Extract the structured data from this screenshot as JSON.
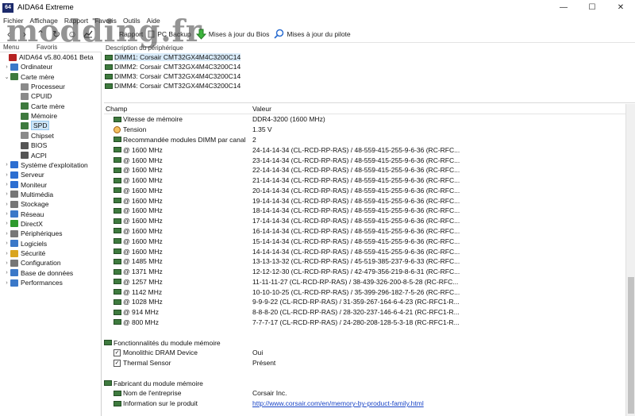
{
  "window": {
    "title": "AIDA64 Extreme",
    "app_icon": "64",
    "controls": [
      "—",
      "☐",
      "✕"
    ]
  },
  "watermark": "modding.fr",
  "menu": [
    "Fichier",
    "Affichage",
    "Rapport",
    "Favoris",
    "Outils",
    "Aide"
  ],
  "toolbar": {
    "items": [
      {
        "label": "Rapport"
      },
      {
        "label": "PC Backup"
      },
      {
        "label": "Mises à jour du Bios"
      },
      {
        "label": "Mises à jour du pilote"
      }
    ]
  },
  "left_tabs": [
    "Menu",
    "Favoris"
  ],
  "tree": [
    {
      "label": "AIDA64 v5.80.4061 Beta",
      "level": 0,
      "exp": "",
      "color": "#b52222"
    },
    {
      "label": "Ordinateur",
      "level": 1,
      "exp": "›",
      "color": "#3a78c8"
    },
    {
      "label": "Carte mère",
      "level": 1,
      "exp": "⌄",
      "color": "#3e7a3e"
    },
    {
      "label": "Processeur",
      "level": 2,
      "exp": "",
      "color": "#8a8a8a"
    },
    {
      "label": "CPUID",
      "level": 2,
      "exp": "",
      "color": "#8a8a8a"
    },
    {
      "label": "Carte mère",
      "level": 2,
      "exp": "",
      "color": "#3e7a3e"
    },
    {
      "label": "Mémoire",
      "level": 2,
      "exp": "",
      "color": "#3e7a3e"
    },
    {
      "label": "SPD",
      "level": 2,
      "exp": "",
      "color": "#3e7a3e",
      "selected": true
    },
    {
      "label": "Chipset",
      "level": 2,
      "exp": "",
      "color": "#8a8a8a"
    },
    {
      "label": "BIOS",
      "level": 2,
      "exp": "",
      "color": "#555555"
    },
    {
      "label": "ACPI",
      "level": 2,
      "exp": "",
      "color": "#555555"
    },
    {
      "label": "Système d'exploitation",
      "level": 1,
      "exp": "›",
      "color": "#2c6ed1"
    },
    {
      "label": "Serveur",
      "level": 1,
      "exp": "›",
      "color": "#2c6ed1"
    },
    {
      "label": "Moniteur",
      "level": 1,
      "exp": "›",
      "color": "#2c6ed1"
    },
    {
      "label": "Multimédia",
      "level": 1,
      "exp": "›",
      "color": "#777777"
    },
    {
      "label": "Stockage",
      "level": 1,
      "exp": "›",
      "color": "#777777"
    },
    {
      "label": "Réseau",
      "level": 1,
      "exp": "›",
      "color": "#3a78c8"
    },
    {
      "label": "DirectX",
      "level": 1,
      "exp": "›",
      "color": "#2e9a2e"
    },
    {
      "label": "Périphériques",
      "level": 1,
      "exp": "›",
      "color": "#777777"
    },
    {
      "label": "Logiciels",
      "level": 1,
      "exp": "›",
      "color": "#3a78c8"
    },
    {
      "label": "Sécurité",
      "level": 1,
      "exp": "›",
      "color": "#d9a520"
    },
    {
      "label": "Configuration",
      "level": 1,
      "exp": "›",
      "color": "#777777"
    },
    {
      "label": "Base de données",
      "level": 1,
      "exp": "›",
      "color": "#3a78c8"
    },
    {
      "label": "Performances",
      "level": 1,
      "exp": "›",
      "color": "#3a78c8"
    }
  ],
  "device_header": "Description du périphérique",
  "devices": [
    {
      "label": "DIMM1: Corsair CMT32GX4M4C3200C14",
      "selected": true
    },
    {
      "label": "DIMM2: Corsair CMT32GX4M4C3200C14"
    },
    {
      "label": "DIMM3: Corsair CMT32GX4M4C3200C14"
    },
    {
      "label": "DIMM4: Corsair CMT32GX4M4C3200C14"
    }
  ],
  "table": {
    "col_field": "Champ",
    "col_value": "Valeur",
    "rows": [
      {
        "field": "Vitesse de mémoire",
        "value": "DDR4-3200 (1600 MHz)",
        "icon": "mem"
      },
      {
        "field": "Tension",
        "value": "1.35 V",
        "icon": "tension"
      },
      {
        "field": "Recommandée modules DIMM par canal",
        "value": "2",
        "icon": "mem"
      },
      {
        "field": "@ 1600 MHz",
        "value": "24-14-14-34  (CL-RCD-RP-RAS) / 48-559-415-255-9-6-36  (RC-RFC...",
        "icon": "mem"
      },
      {
        "field": "@ 1600 MHz",
        "value": "23-14-14-34  (CL-RCD-RP-RAS) / 48-559-415-255-9-6-36  (RC-RFC...",
        "icon": "mem"
      },
      {
        "field": "@ 1600 MHz",
        "value": "22-14-14-34  (CL-RCD-RP-RAS) / 48-559-415-255-9-6-36  (RC-RFC...",
        "icon": "mem"
      },
      {
        "field": "@ 1600 MHz",
        "value": "21-14-14-34  (CL-RCD-RP-RAS) / 48-559-415-255-9-6-36  (RC-RFC...",
        "icon": "mem"
      },
      {
        "field": "@ 1600 MHz",
        "value": "20-14-14-34  (CL-RCD-RP-RAS) / 48-559-415-255-9-6-36  (RC-RFC...",
        "icon": "mem"
      },
      {
        "field": "@ 1600 MHz",
        "value": "19-14-14-34  (CL-RCD-RP-RAS) / 48-559-415-255-9-6-36  (RC-RFC...",
        "icon": "mem"
      },
      {
        "field": "@ 1600 MHz",
        "value": "18-14-14-34  (CL-RCD-RP-RAS) / 48-559-415-255-9-6-36  (RC-RFC...",
        "icon": "mem"
      },
      {
        "field": "@ 1600 MHz",
        "value": "17-14-14-34  (CL-RCD-RP-RAS) / 48-559-415-255-9-6-36  (RC-RFC...",
        "icon": "mem"
      },
      {
        "field": "@ 1600 MHz",
        "value": "16-14-14-34  (CL-RCD-RP-RAS) / 48-559-415-255-9-6-36  (RC-RFC...",
        "icon": "mem"
      },
      {
        "field": "@ 1600 MHz",
        "value": "15-14-14-34  (CL-RCD-RP-RAS) / 48-559-415-255-9-6-36  (RC-RFC...",
        "icon": "mem"
      },
      {
        "field": "@ 1600 MHz",
        "value": "14-14-14-34  (CL-RCD-RP-RAS) / 48-559-415-255-9-6-36  (RC-RFC...",
        "icon": "mem"
      },
      {
        "field": "@ 1485 MHz",
        "value": "13-13-13-32  (CL-RCD-RP-RAS) / 45-519-385-237-9-6-33  (RC-RFC...",
        "icon": "mem"
      },
      {
        "field": "@ 1371 MHz",
        "value": "12-12-12-30  (CL-RCD-RP-RAS) / 42-479-356-219-8-6-31  (RC-RFC...",
        "icon": "mem"
      },
      {
        "field": "@ 1257 MHz",
        "value": "11-11-11-27  (CL-RCD-RP-RAS) / 38-439-326-200-8-5-28  (RC-RFC...",
        "icon": "mem"
      },
      {
        "field": "@ 1142 MHz",
        "value": "10-10-10-25  (CL-RCD-RP-RAS) / 35-399-296-182-7-5-26  (RC-RFC...",
        "icon": "mem"
      },
      {
        "field": "@ 1028 MHz",
        "value": "9-9-9-22  (CL-RCD-RP-RAS) / 31-359-267-164-6-4-23  (RC-RFC1-R...",
        "icon": "mem"
      },
      {
        "field": "@ 914 MHz",
        "value": "8-8-8-20  (CL-RCD-RP-RAS) / 28-320-237-146-6-4-21  (RC-RFC1-R...",
        "icon": "mem"
      },
      {
        "field": "@ 800 MHz",
        "value": "7-7-7-17  (CL-RCD-RP-RAS) / 24-280-208-128-5-3-18  (RC-RFC1-R...",
        "icon": "mem"
      },
      {
        "field": "",
        "value": "",
        "icon": ""
      },
      {
        "field": "Fonctionnalités du module mémoire",
        "value": "",
        "icon": "mem",
        "section": true
      },
      {
        "field": "Monolithic DRAM Device",
        "value": "Oui",
        "icon": "check"
      },
      {
        "field": "Thermal Sensor",
        "value": "Présent",
        "icon": "check"
      },
      {
        "field": "",
        "value": "",
        "icon": ""
      },
      {
        "field": "Fabricant du module mémoire",
        "value": "",
        "icon": "mem",
        "section": true
      },
      {
        "field": "Nom de l'entreprise",
        "value": "Corsair Inc.",
        "icon": "mem"
      },
      {
        "field": "Information sur le produit",
        "value": "http://www.corsair.com/en/memory-by-product-family.html",
        "icon": "mem",
        "link": true
      }
    ]
  }
}
